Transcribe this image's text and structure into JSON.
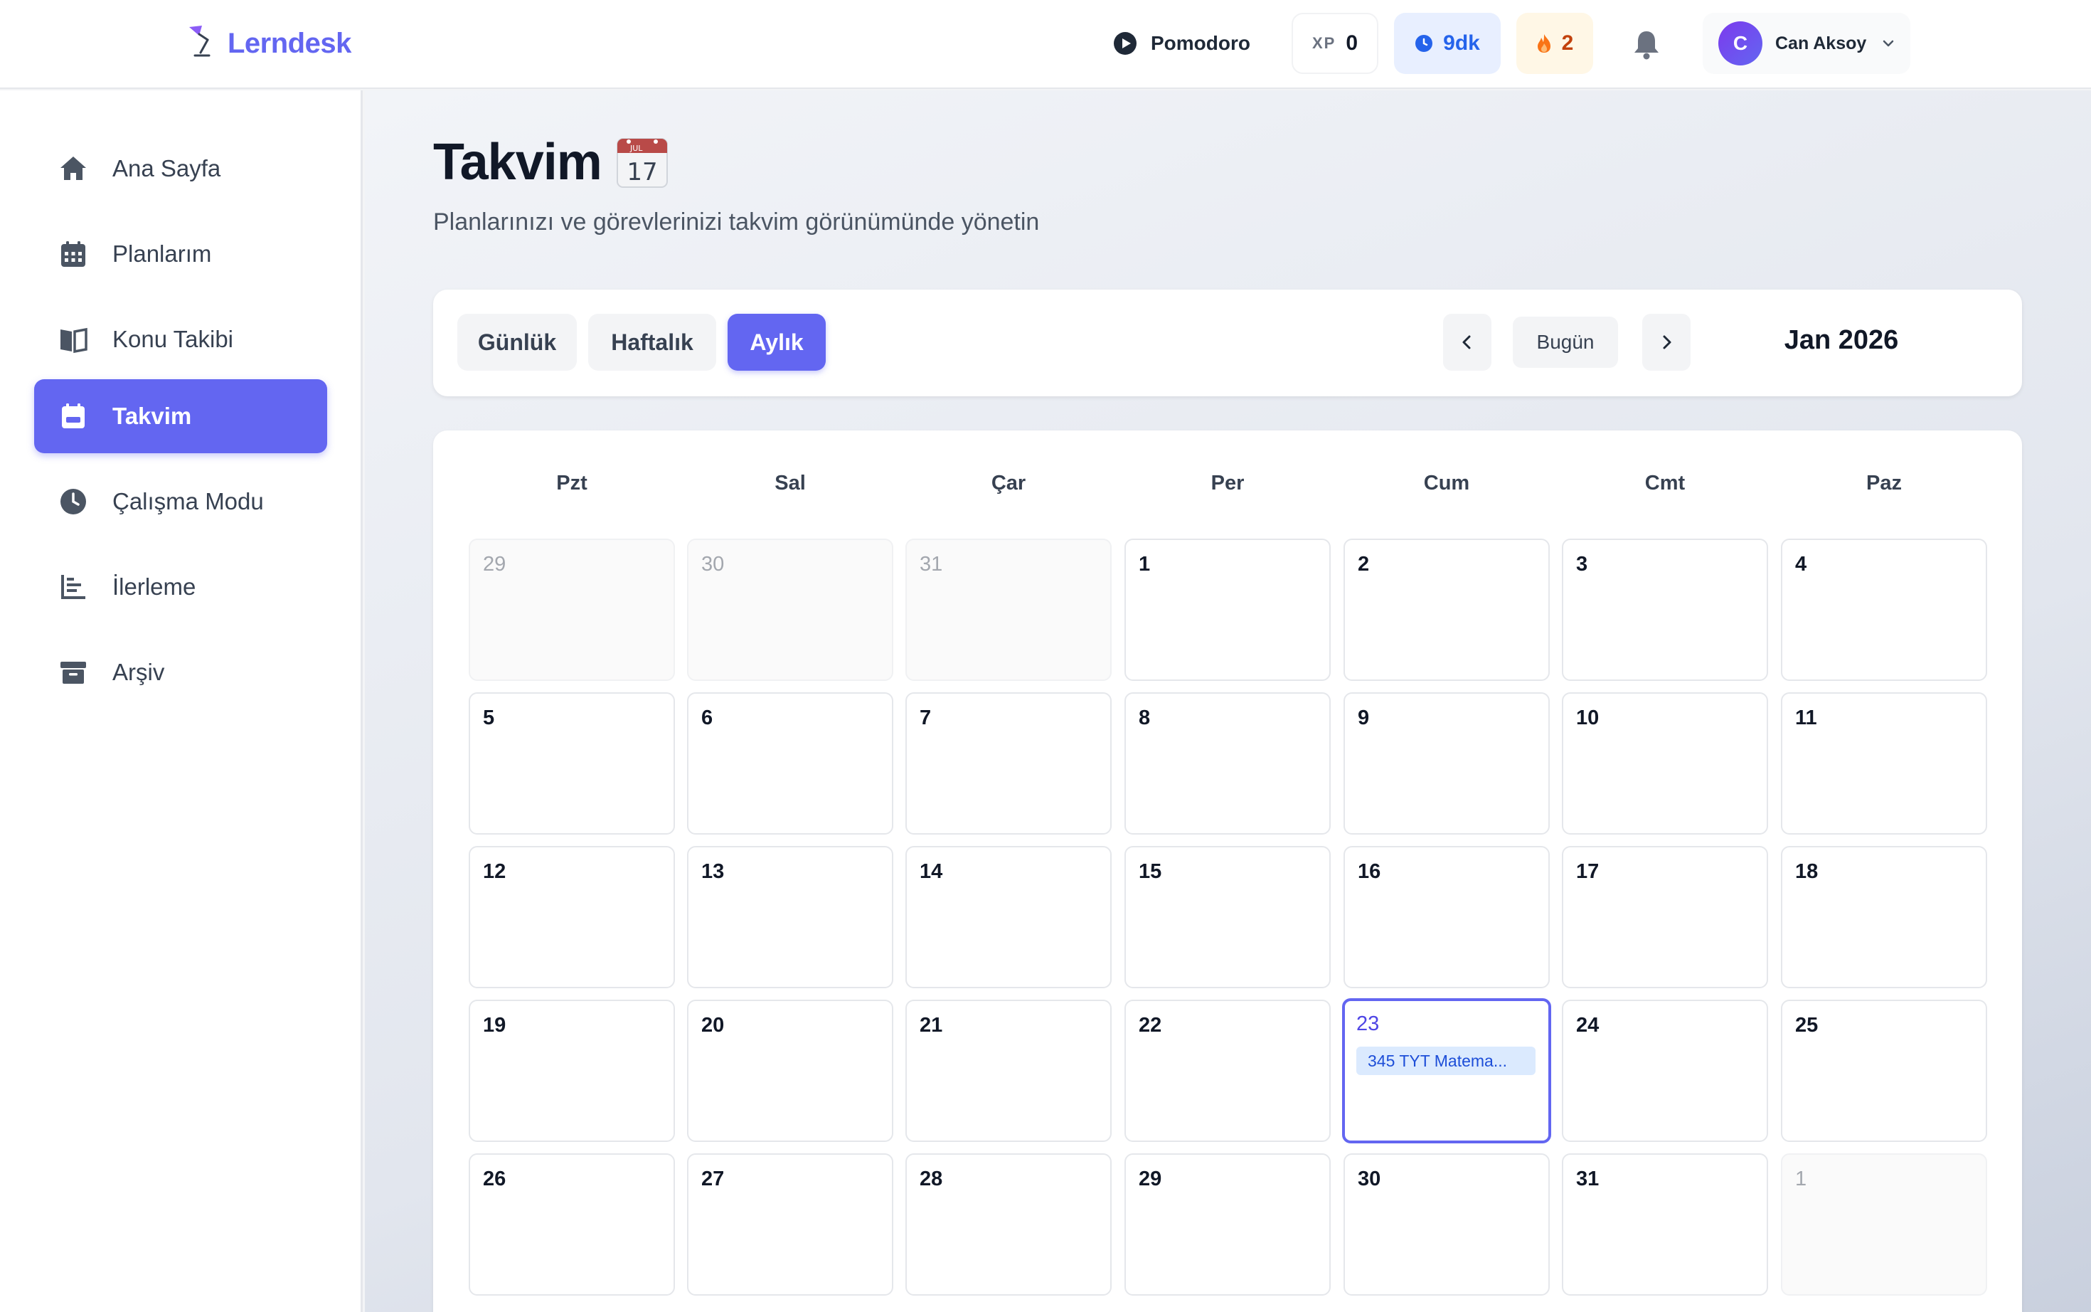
{
  "app": {
    "name": "Lerndesk"
  },
  "topbar": {
    "pomodoro_label": "Pomodoro",
    "xp_label": "XP",
    "xp_value": "0",
    "time_value": "9dk",
    "streak_value": "2",
    "user": {
      "initial": "C",
      "name": "Can Aksoy"
    }
  },
  "sidebar": {
    "items": [
      {
        "label": "Ana Sayfa",
        "icon": "home-icon"
      },
      {
        "label": "Planlarım",
        "icon": "calendar-grid-icon"
      },
      {
        "label": "Konu Takibi",
        "icon": "book-open-icon"
      },
      {
        "label": "Takvim",
        "icon": "calendar-icon",
        "active": true
      },
      {
        "label": "Çalışma Modu",
        "icon": "clock-icon"
      },
      {
        "label": "İlerleme",
        "icon": "bar-chart-icon"
      },
      {
        "label": "Arşiv",
        "icon": "archive-icon"
      }
    ]
  },
  "page": {
    "title": "Takvim",
    "title_emoji": "calendar-emoji-icon",
    "subtitle": "Planlarınızı ve görevlerinizi takvim görünümünde yönetin"
  },
  "toolbar": {
    "views": [
      "Günlük",
      "Haftalık",
      "Aylık"
    ],
    "active_view": "Aylık",
    "today_label": "Bugün",
    "month_label": "Jan 2026",
    "emoji_month": "JUL",
    "emoji_day": "17"
  },
  "calendar": {
    "weekdays": [
      "Pzt",
      "Sal",
      "Çar",
      "Per",
      "Cum",
      "Cmt",
      "Paz"
    ],
    "weeks": [
      [
        {
          "d": "29",
          "out": true
        },
        {
          "d": "30",
          "out": true
        },
        {
          "d": "31",
          "out": true
        },
        {
          "d": "1"
        },
        {
          "d": "2"
        },
        {
          "d": "3"
        },
        {
          "d": "4"
        }
      ],
      [
        {
          "d": "5"
        },
        {
          "d": "6"
        },
        {
          "d": "7"
        },
        {
          "d": "8"
        },
        {
          "d": "9"
        },
        {
          "d": "10"
        },
        {
          "d": "11"
        }
      ],
      [
        {
          "d": "12"
        },
        {
          "d": "13"
        },
        {
          "d": "14"
        },
        {
          "d": "15"
        },
        {
          "d": "16"
        },
        {
          "d": "17"
        },
        {
          "d": "18"
        }
      ],
      [
        {
          "d": "19"
        },
        {
          "d": "20"
        },
        {
          "d": "21"
        },
        {
          "d": "22"
        },
        {
          "d": "23",
          "today": true,
          "events": [
            "345 TYT Matema..."
          ]
        },
        {
          "d": "24"
        },
        {
          "d": "25"
        }
      ],
      [
        {
          "d": "26"
        },
        {
          "d": "27"
        },
        {
          "d": "28"
        },
        {
          "d": "29"
        },
        {
          "d": "30"
        },
        {
          "d": "31"
        },
        {
          "d": "1",
          "out": true
        }
      ]
    ]
  },
  "colors": {
    "accent": "#6366f1",
    "event_bg": "#dbeafe",
    "event_text": "#1d4ed8",
    "time_pill_bg": "#e8efff",
    "streak_pill_bg": "#fff7e6"
  }
}
